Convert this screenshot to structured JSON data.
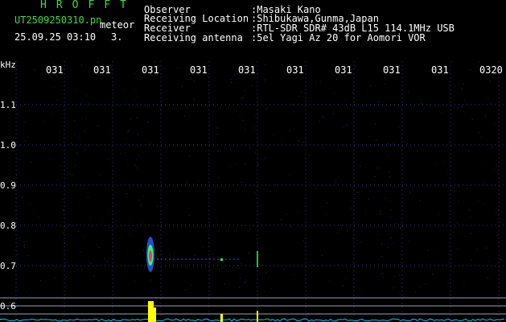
{
  "header": {
    "app_title": "HROFFT",
    "file_name": "UT2509250310.pn",
    "meteor_label": "meteor",
    "date_time": "25.09.25 03:10",
    "count_value": "3.",
    "observer_label": "Observer",
    "observer_value": ":Masaki Kano",
    "location_label": "Receiving Location",
    "location_value": ":Shibukawa,Gunma,Japan",
    "receiver_label": "Receiver",
    "receiver_value": ":RTL-SDR SDR# 43dB L15 114.1MHz USB",
    "antenna_label": "Receiving antenna",
    "antenna_value": ":5el Yagi Az 20 for Aomori VOR"
  },
  "plot": {
    "y_unit": "kHz",
    "y_ticks": [
      "1.1",
      "1.0",
      "0.9",
      "0.8",
      "0.7",
      "0.6"
    ],
    "x_ticks": [
      "031",
      "031",
      "031",
      "031",
      "031",
      "031",
      "031",
      "031",
      "031",
      "0320"
    ],
    "colors": {
      "background": "#000000",
      "grid_dots": "#2a3a8c",
      "reference_lines": "#9aa0b8",
      "baseline": "#00c8ff",
      "echo_core": "#ff2a8a",
      "echo_mid": "#2bff6a",
      "echo_outer": "#3060ff",
      "histogram": "#ffff00"
    }
  }
}
